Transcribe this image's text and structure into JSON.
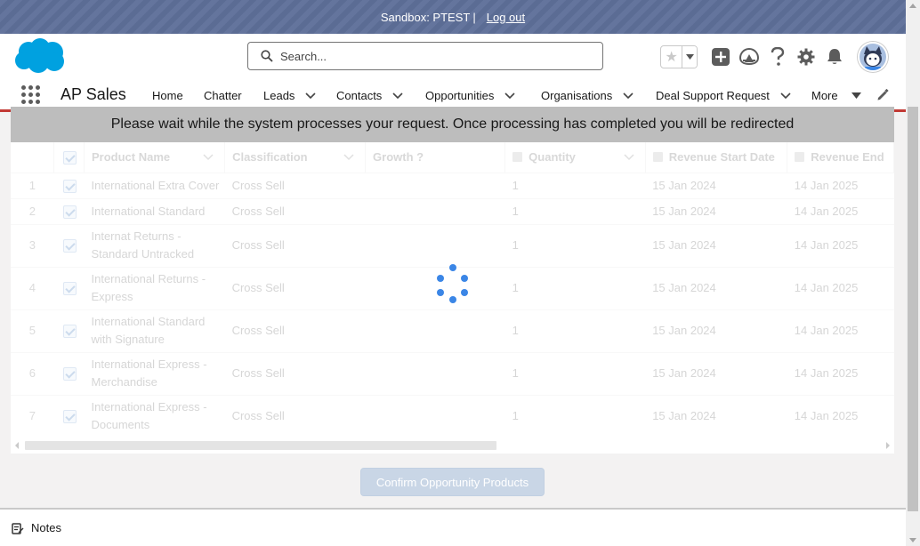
{
  "sandbox": {
    "text": "Sandbox: PTEST",
    "separator": "|",
    "logout": "Log out"
  },
  "header": {
    "search_placeholder": "Search...",
    "icons": [
      "favorites-star-icon",
      "favorites-dropdown-icon",
      "global-actions-add-icon",
      "trailhead-guidance-icon",
      "help-icon",
      "setup-gear-icon",
      "notifications-bell-icon",
      "user-avatar"
    ]
  },
  "nav": {
    "app_name": "AP Sales",
    "items": [
      {
        "label": "Home",
        "dropdown": false
      },
      {
        "label": "Chatter",
        "dropdown": false
      },
      {
        "label": "Leads",
        "dropdown": true
      },
      {
        "label": "Contacts",
        "dropdown": true
      },
      {
        "label": "Opportunities",
        "dropdown": true
      },
      {
        "label": "Organisations",
        "dropdown": true
      },
      {
        "label": "Deal Support Request",
        "dropdown": true
      }
    ],
    "more": "More"
  },
  "banner": {
    "message": "Please wait while the system processes your request. Once processing has completed you will be redirected"
  },
  "table": {
    "columns": [
      "Product Name",
      "Classification",
      "Growth ?",
      "Quantity",
      "Revenue Start Date",
      "Revenue End"
    ],
    "rows": [
      {
        "num": "1",
        "product": "International Extra Cover",
        "classification": "Cross Sell",
        "growth": "",
        "quantity": "1",
        "start": "15 Jan 2024",
        "end": "14 Jan 2025"
      },
      {
        "num": "2",
        "product": "International Standard",
        "classification": "Cross Sell",
        "growth": "",
        "quantity": "1",
        "start": "15 Jan 2024",
        "end": "14 Jan 2025"
      },
      {
        "num": "3",
        "product": "Internat Returns - Standard Untracked",
        "classification": "Cross Sell",
        "growth": "",
        "quantity": "1",
        "start": "15 Jan 2024",
        "end": "14 Jan 2025"
      },
      {
        "num": "4",
        "product": "International Returns - Express",
        "classification": "Cross Sell",
        "growth": "",
        "quantity": "1",
        "start": "15 Jan 2024",
        "end": "14 Jan 2025"
      },
      {
        "num": "5",
        "product": "International Standard with Signature",
        "classification": "Cross Sell",
        "growth": "",
        "quantity": "1",
        "start": "15 Jan 2024",
        "end": "14 Jan 2025"
      },
      {
        "num": "6",
        "product": "International Express - Merchandise",
        "classification": "Cross Sell",
        "growth": "",
        "quantity": "1",
        "start": "15 Jan 2024",
        "end": "14 Jan 2025"
      },
      {
        "num": "7",
        "product": "International Express - Documents",
        "classification": "Cross Sell",
        "growth": "",
        "quantity": "1",
        "start": "15 Jan 2024",
        "end": "14 Jan 2025"
      }
    ]
  },
  "actions": {
    "confirm": "Confirm Opportunity Products"
  },
  "footer": {
    "notes": "Notes"
  },
  "colors": {
    "sandbox_bar": "#5e6f99",
    "brand_blue": "#00a1e0",
    "nav_accent": "#c23934",
    "spinner": "#3b86e6",
    "button_disabled": "#c9d6e6"
  }
}
